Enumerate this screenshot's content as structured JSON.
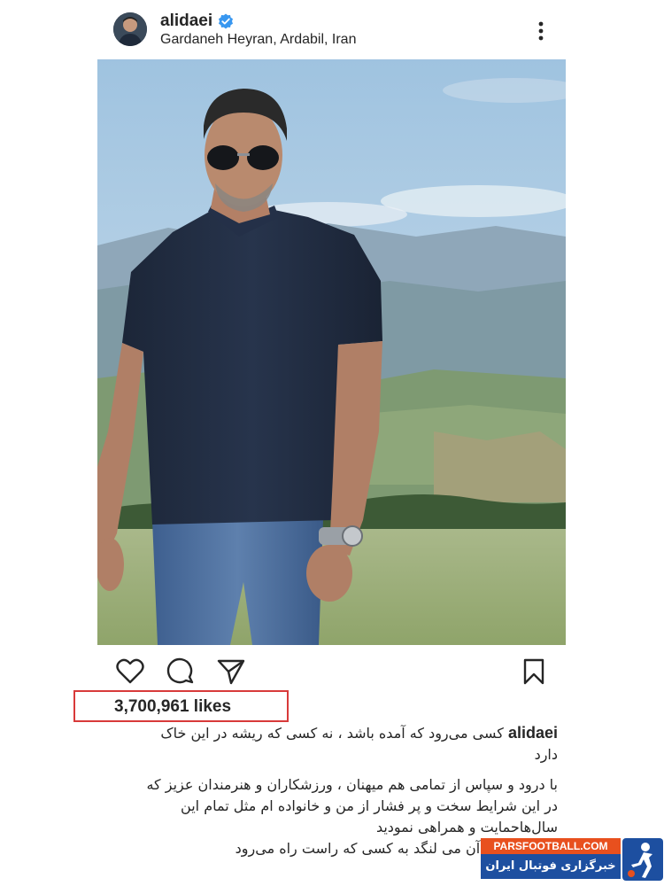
{
  "post": {
    "username": "alidaei",
    "location": "Gardaneh Heyran, Ardabil, Iran",
    "likes": "3,700,961 likes"
  },
  "icons": {
    "avatar": "avatar",
    "verified": "verified-badge-icon",
    "more": "more-options-icon",
    "like": "heart-icon",
    "comment": "comment-bubble-icon",
    "share": "paper-plane-icon",
    "save": "bookmark-icon"
  },
  "caption": {
    "username": "alidaei",
    "line1": "کسی می‌رود که آمده باشد ، نه کسی که ریشه در این خاک",
    "line2": "دارد",
    "line3": "با درود و سپاس از تمامی هم میهنان ، ورزشکاران و هنرمندان عزیز که",
    "line4": "در این شرایط سخت و پر فشار از من و خانواده ام  مثل تمام این",
    "line5": "سال‌هاحمایت و همراهی نمودید",
    "line6": "...که همه در آن می لنگد به کسی که راست راه می‌رود"
  },
  "watermark": {
    "brand": "PARSFOOTBALL.COM",
    "tagline": "خبرگزاری فوتبال ایران"
  },
  "colors": {
    "highlight_box": "#d83a3a",
    "verified": "#3897f0",
    "watermark_orange": "#e8501e",
    "watermark_blue": "#1d4fa0"
  }
}
